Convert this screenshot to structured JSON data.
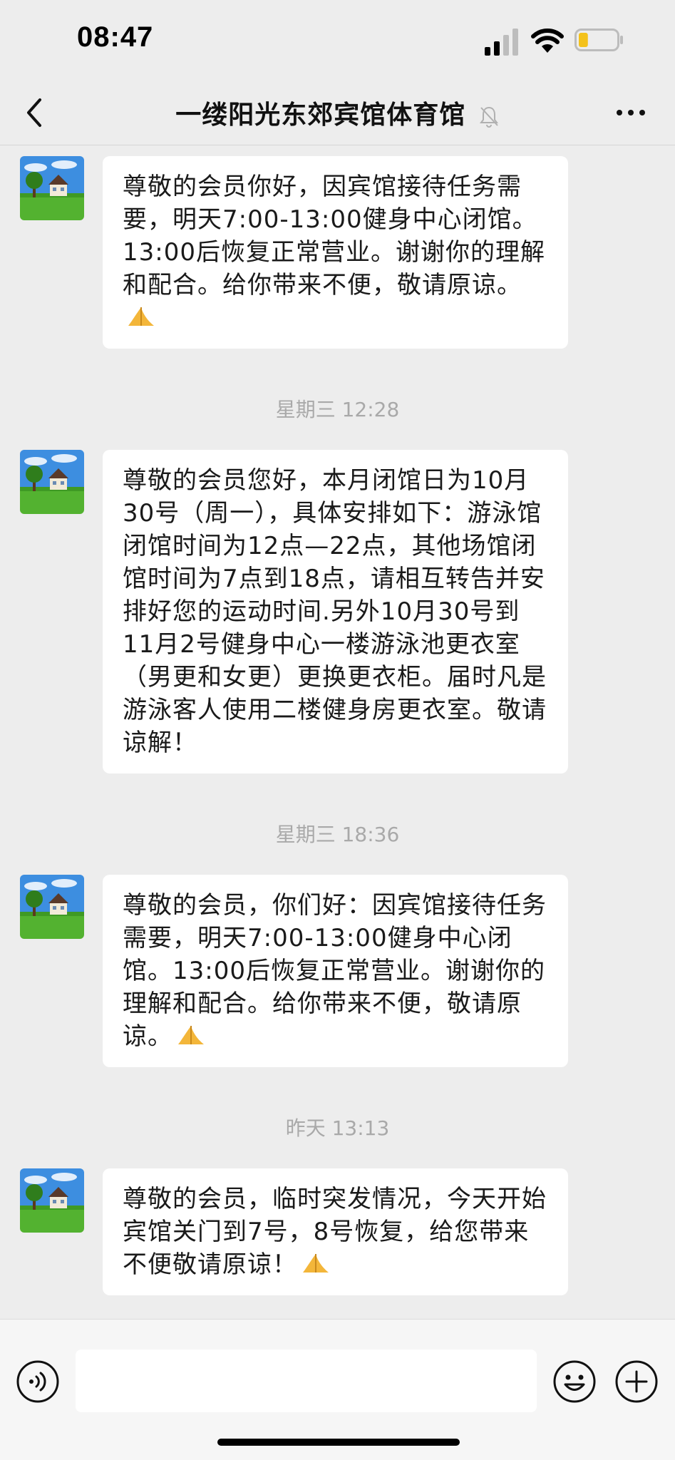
{
  "status_bar": {
    "time": "08:47",
    "battery_level": 0.25
  },
  "nav": {
    "title": "一缕阳光东郊宾馆体育馆",
    "icons": [
      "back-icon",
      "mute-bell-icon",
      "more-icon"
    ]
  },
  "messages": [
    {
      "text": "尊敬的会员你好，因宾馆接待任务需要，明天7:00-13:00健身中心闭馆。13:00后恢复正常营业。谢谢你的理解和配合。给你带来不便，敬请原谅。",
      "emoji": "folded-hands-icon"
    },
    {
      "timestamp": "星期三 12:28"
    },
    {
      "text": "尊敬的会员您好，本月闭馆日为10月30号（周一），具体安排如下：游泳馆闭馆时间为12点—22点，其他场馆闭馆时间为7点到18点，请相互转告并安排好您的运动时间.另外10月30号到11月2号健身中心一楼游泳池更衣室（男更和女更）更换更衣柜。届时凡是游泳客人使用二楼健身房更衣室。敬请谅解！"
    },
    {
      "timestamp": "星期三 18:36"
    },
    {
      "text": "尊敬的会员，你们好：因宾馆接待任务需要，明天7:00-13:00健身中心闭馆。13:00后恢复正常营业。谢谢你的理解和配合。给你带来不便，敬请原谅。",
      "emoji": "folded-hands-icon"
    },
    {
      "timestamp": "昨天 13:13"
    },
    {
      "text": "尊敬的会员，临时突发情况，今天开始宾馆关门到7号，8号恢复，给您带来不便敬请原谅！",
      "emoji": "folded-hands-icon"
    }
  ],
  "input_bar": {
    "placeholder": "",
    "icons": [
      "voice-icon",
      "emoji-icon",
      "plus-icon"
    ]
  },
  "colors": {
    "background": "#ededed",
    "bubble": "#ffffff",
    "timestamp": "#a9a9a9",
    "input_bar": "#f6f6f6"
  }
}
